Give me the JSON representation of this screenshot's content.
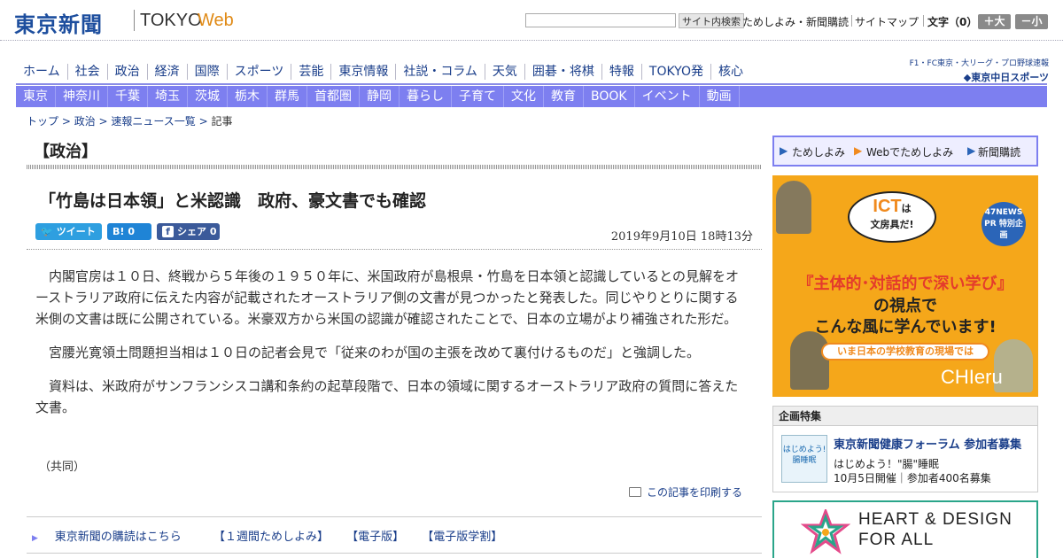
{
  "header": {
    "logo": "東京新聞",
    "logo_tokyo": "TOKYO",
    "logo_web": "Web",
    "search_placeholder": "",
    "search_button": "サイト内検索",
    "links": [
      "ためしよみ・新聞購読",
      "サイトマップ"
    ],
    "font_size_label": "文字（0）",
    "font_larger": "＋大",
    "font_smaller": "－小"
  },
  "global_nav": [
    "ホーム",
    "社会",
    "政治",
    "経済",
    "国際",
    "スポーツ",
    "芸能",
    "東京情報",
    "社説・コラム",
    "天気",
    "囲碁・将棋",
    "特報",
    "TOKYO発",
    "核心"
  ],
  "chunichi": {
    "top": "F1・FC東京・大リーグ・プロ野球速報",
    "bottom": "◆東京中日スポーツ"
  },
  "region_nav": [
    "東京",
    "神奈川",
    "千葉",
    "埼玉",
    "茨城",
    "栃木",
    "群馬",
    "首都圏",
    "静岡",
    "暮らし",
    "子育て",
    "文化",
    "教育",
    "BOOK",
    "イベント",
    "動画"
  ],
  "breadcrumb": {
    "items": [
      "トップ",
      "政治",
      "速報ニュース一覧"
    ],
    "current": "記事",
    "sep": " > "
  },
  "section_title": "【政治】",
  "article": {
    "headline": "「竹島は日本領」と米認識　政府、豪文書でも確認",
    "share": {
      "tweet": "ツイート",
      "hatena_icon": "B!",
      "hatena_count": "0",
      "facebook": "シェア",
      "facebook_count": "0"
    },
    "date": "2019年9月10日 18時13分",
    "paragraphs": [
      "内閣官房は１０日、終戦から５年後の１９５０年に、米国政府が島根県・竹島を日本領と認識しているとの見解をオーストラリア政府に伝えた内容が記載されたオーストラリア側の文書が見つかったと発表した。同じやりとりに関する米側の文書は既に公開されている。米豪双方から米国の認識が確認されたことで、日本の立場がより補強された形だ。",
      "宮腰光寛領土問題担当相は１０日の記者会見で「従来のわが国の主張を改めて裏付けるものだ」と強調した。",
      "資料は、米政府がサンフランシスコ講和条約の起草段階で、日本の領域に関するオーストラリア政府の質問に答えた文書。"
    ],
    "credit": "（共同）",
    "print": "この記事を印刷する"
  },
  "footer_links": [
    "東京新聞の購読はこちら",
    "【１週間ためしよみ】",
    "【電子版】",
    "【電子版学割】"
  ],
  "sidebar": {
    "nav": [
      "ためしよみ",
      "Webでためしよみ",
      "新聞購読"
    ],
    "ad1": {
      "ict": "ICT",
      "ict_wa": "は",
      "tool": "文房具だ!",
      "badge": "47NEWS PR 特別企画",
      "line1": "『主体的･対話的で深い学び』",
      "line2": "の視点で",
      "line3": "こんな風に学んでいます!",
      "ribbon": "いま日本の学校教育の現場では",
      "brand": "CHIeru"
    },
    "feature": {
      "heading": "企画特集",
      "thumb": "はじめよう!腸睡眠",
      "title": "東京新聞健康フォーラム 参加者募集",
      "subtitle": "はじめよう！\"腸\"睡眠",
      "info": "10月5日開催｜参加者400名募集"
    },
    "ad2": {
      "line1": "HEART & DESIGN",
      "line2": "FOR ALL"
    }
  },
  "colors": {
    "brand_blue": "#1d4e9e",
    "nav_purple": "#7d7ff0",
    "twitter": "#2e9fe0",
    "hatena": "#1f84d6",
    "facebook": "#3b5a9a"
  }
}
